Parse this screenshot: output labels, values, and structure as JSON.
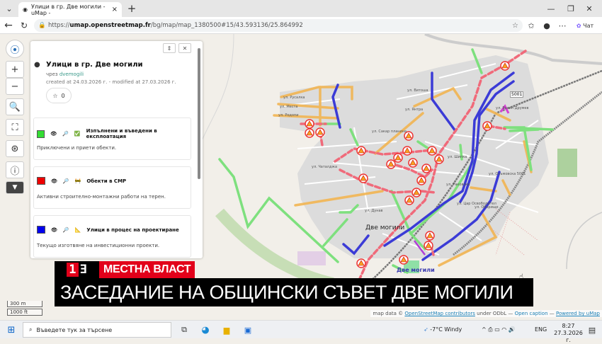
{
  "browser": {
    "tab_title": "Улици в гр. Две могили - uMap -",
    "url_prefix": "https://",
    "url_host": "umap.openstreetmap.fr",
    "url_path": "/bg/map/map_1380500#15/43.593136/25.864992",
    "copilot_label": "Чат"
  },
  "panel": {
    "title": "Улици в гр. Две могили",
    "by_prefix": "чрез",
    "author": "dvemogili",
    "dates": "created at 24.03.2026 г. - modified at 27.03.2026 г.",
    "stars": "0",
    "layers": [
      {
        "title": "Изпълнени и въведени в експлоатация",
        "desc": "Приключени и приети обекти.",
        "color": "#33dd33",
        "emoji": "✅"
      },
      {
        "title": "Обекти в СМР",
        "desc": "Активни строително-монтажни работи на терен.",
        "color": "#ee0000",
        "emoji": "🚧"
      },
      {
        "title": "Улици в процес на проектиране",
        "desc": "Текущо изготвяне на инвестиционни проекти.",
        "color": "#0000ee",
        "emoji": "📐"
      }
    ]
  },
  "map": {
    "town_label": "Две могили",
    "station_label": "Две могили",
    "road_label": "5001",
    "street_labels": [
      "ул. Русалка",
      "ул. Места",
      "ул. Родопи",
      "ул. Янтра",
      "ул. Сакар планина",
      "ул. Шипка",
      "ул. Раковски",
      "ул. Цар Освободител",
      "ул. Оборище",
      "ул. Васил Друмев",
      "ул. Чаталджа",
      "ул. Витоша",
      "ул. Дунав",
      "ул. Осъмовска 5001"
    ],
    "scale_m": "300 m",
    "scale_ft": "1000 ft",
    "attribution": {
      "prefix": "map data ©",
      "osm": "OpenStreetMap contributors",
      "mid": "under ODbL —",
      "caption": "Open caption",
      "sep": "—",
      "powered": "Powered by uMap"
    }
  },
  "overlay": {
    "channel": "13",
    "kicker": "МЕСТНА ВЛАСТ",
    "headline": "ЗАСЕДАНИЕ НА ОБЩИНСКИ СЪВЕТ ДВЕ МОГИЛИ",
    "brand_color": "#e2001a"
  },
  "taskbar": {
    "search_placeholder": "Въведете тук за търсене",
    "weather": "-7°C  Windy",
    "lang": "ENG",
    "time": "8:27",
    "date": "27.3.2026 г."
  }
}
